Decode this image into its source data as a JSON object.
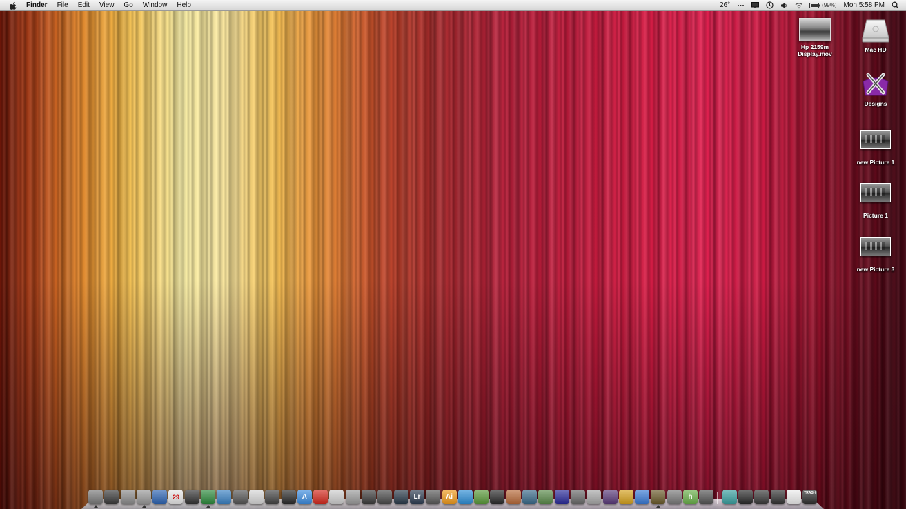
{
  "menubar": {
    "app_name": "Finder",
    "menus": [
      "File",
      "Edit",
      "View",
      "Go",
      "Window",
      "Help"
    ],
    "temperature": "26°",
    "battery_percent": "(99%)",
    "clock": "Mon 5:58 PM",
    "status_icons": [
      "dots-icon",
      "display-icon",
      "time-machine-icon",
      "volume-icon",
      "wifi-icon",
      "battery-icon",
      "spotlight-icon"
    ]
  },
  "desktop": {
    "icons": [
      {
        "name": "hp-display-movie",
        "label": "Hp 2159m\nDisplay.mov",
        "icon": "movie-file-icon"
      },
      {
        "name": "mac-hd",
        "label": "Mac HD",
        "icon": "hard-drive-icon"
      },
      {
        "name": "designs",
        "label": "Designs",
        "icon": "designs-folder-icon"
      },
      {
        "name": "new-picture-1",
        "label": "new Picture 1",
        "icon": "image-thumbnail-icon"
      },
      {
        "name": "picture-1",
        "label": "Picture 1",
        "icon": "image-thumbnail-icon"
      },
      {
        "name": "new-picture-3",
        "label": "new Picture 3",
        "icon": "image-thumbnail-icon"
      }
    ]
  },
  "dock": {
    "items": [
      {
        "icon": "app-icon",
        "color": "#7a7a7a",
        "glyph": "",
        "running": true
      },
      {
        "icon": "dashboard-icon",
        "color": "#3a3a3a",
        "glyph": "",
        "running": false
      },
      {
        "icon": "finder-icon",
        "color": "#8c8c8c",
        "glyph": "",
        "running": false
      },
      {
        "icon": "system-preferences-icon",
        "color": "#9a9a9a",
        "glyph": "",
        "running": true
      },
      {
        "icon": "safari-icon",
        "color": "#2d64b3",
        "glyph": "",
        "running": false
      },
      {
        "icon": "ical-icon",
        "color": "#e8e8e8",
        "glyph": "29",
        "running": false
      },
      {
        "icon": "screen-icon",
        "color": "#333333",
        "glyph": "",
        "running": false
      },
      {
        "icon": "money-icon",
        "color": "#2c8a3c",
        "glyph": "",
        "running": true
      },
      {
        "icon": "display-icon",
        "color": "#3b82c4",
        "glyph": "",
        "running": false
      },
      {
        "icon": "magnifier-icon",
        "color": "#555555",
        "glyph": "",
        "running": false
      },
      {
        "icon": "itunes-icon",
        "color": "#d8d8d8",
        "glyph": "",
        "running": false
      },
      {
        "icon": "video-editor-icon",
        "color": "#444444",
        "glyph": "",
        "running": false
      },
      {
        "icon": "clapperboard-icon",
        "color": "#2a2a2a",
        "glyph": "",
        "running": false
      },
      {
        "icon": "app-store-icon",
        "color": "#3d8de0",
        "glyph": "A",
        "running": false
      },
      {
        "icon": "flame-icon",
        "color": "#d52a1e",
        "glyph": "",
        "running": false
      },
      {
        "icon": "microphone-icon",
        "color": "#cfcfcf",
        "glyph": "",
        "running": false
      },
      {
        "icon": "tools-icon",
        "color": "#9c9c9c",
        "glyph": "",
        "running": false
      },
      {
        "icon": "camera-icon",
        "color": "#3c3c3c",
        "glyph": "",
        "running": false
      },
      {
        "icon": "film-icon",
        "color": "#4a4a4a",
        "glyph": "",
        "running": false
      },
      {
        "icon": "aperture-icon",
        "color": "#2a3a4a",
        "glyph": "",
        "running": false
      },
      {
        "icon": "lightroom-icon",
        "color": "#2e3d52",
        "glyph": "Lr",
        "running": false
      },
      {
        "icon": "final-cut-icon",
        "color": "#5a5a5a",
        "glyph": "",
        "running": false
      },
      {
        "icon": "illustrator-icon",
        "color": "#f19b1c",
        "glyph": "Ai",
        "running": false
      },
      {
        "icon": "wave-icon",
        "color": "#2f8fd6",
        "glyph": "",
        "running": false
      },
      {
        "icon": "plant-icon",
        "color": "#5a9a3a",
        "glyph": "",
        "running": false
      },
      {
        "icon": "chess-icon",
        "color": "#2a2a2a",
        "glyph": "",
        "running": false
      },
      {
        "icon": "bowl-icon",
        "color": "#b86a3a",
        "glyph": "",
        "running": false
      },
      {
        "icon": "compass-icon",
        "color": "#3a6a8a",
        "glyph": "",
        "running": false
      },
      {
        "icon": "map-icon",
        "color": "#5a8a4a",
        "glyph": "",
        "running": false
      },
      {
        "icon": "unreal-icon",
        "color": "#2a2a9a",
        "glyph": "",
        "running": false
      },
      {
        "icon": "rifle-icon",
        "color": "#6a6a6a",
        "glyph": "",
        "running": false
      },
      {
        "icon": "spark-icon",
        "color": "#a8a8a8",
        "glyph": "",
        "running": false
      },
      {
        "icon": "photo-icon",
        "color": "#5a3a7a",
        "glyph": "",
        "running": false
      },
      {
        "icon": "warner-icon",
        "color": "#d6a21e",
        "glyph": "",
        "running": false
      },
      {
        "icon": "orb-icon",
        "color": "#3a7ad6",
        "glyph": "",
        "running": false
      },
      {
        "icon": "game-icon",
        "color": "#6a5a2a",
        "glyph": "",
        "running": true
      },
      {
        "icon": "utility-icon",
        "color": "#7a7a7a",
        "glyph": "",
        "running": false
      },
      {
        "icon": "h-app-icon",
        "color": "#6ab04a",
        "glyph": "h",
        "running": false
      },
      {
        "icon": "script-icon",
        "color": "#555555",
        "glyph": "",
        "running": false
      },
      {
        "icon": "separator",
        "color": "",
        "glyph": "",
        "running": false
      },
      {
        "icon": "stack-icon",
        "color": "#3aa0a0",
        "glyph": "",
        "running": false
      },
      {
        "icon": "applications-icon",
        "color": "#2a2a2a",
        "glyph": "",
        "running": false
      },
      {
        "icon": "folder-icon",
        "color": "#3a3a3a",
        "glyph": "",
        "running": false
      },
      {
        "icon": "downloads-icon",
        "color": "#333333",
        "glyph": "",
        "running": false
      },
      {
        "icon": "documents-icon",
        "color": "#eeeeee",
        "glyph": "",
        "running": false
      },
      {
        "icon": "trash-icon",
        "color": "#2f2f2f",
        "glyph": "",
        "running": false
      }
    ],
    "trash_label": "TRASH"
  }
}
